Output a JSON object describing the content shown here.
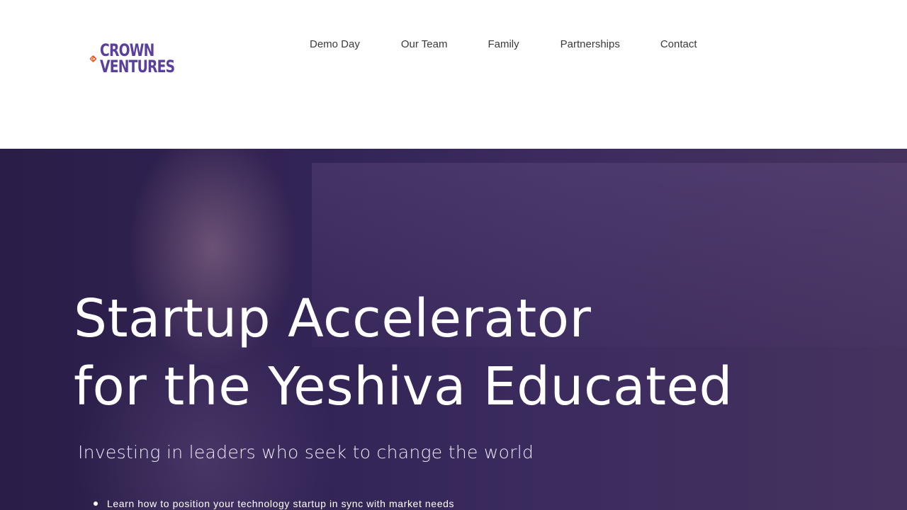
{
  "brand": {
    "logo_line1": "CROWN",
    "logo_line2": "VENTURES",
    "primary_color": "#e85c2a",
    "secondary_color": "#5b3f9d",
    "logo_icon": "crown-ventures-logo-icon"
  },
  "nav": {
    "items": [
      {
        "label": "Demo Day"
      },
      {
        "label": "Our Team"
      },
      {
        "label": "Family"
      },
      {
        "label": "Partnerships"
      },
      {
        "label": "Contact"
      }
    ]
  },
  "hero": {
    "title_line1": "Startup Accelerator",
    "title_line2": "for the Yeshiva Educated",
    "subtitle": "Investing in leaders who seek to change the world",
    "bullets": [
      "Learn how to position your technology startup in sync with market needs"
    ],
    "overlay_color": "#2e2150"
  }
}
